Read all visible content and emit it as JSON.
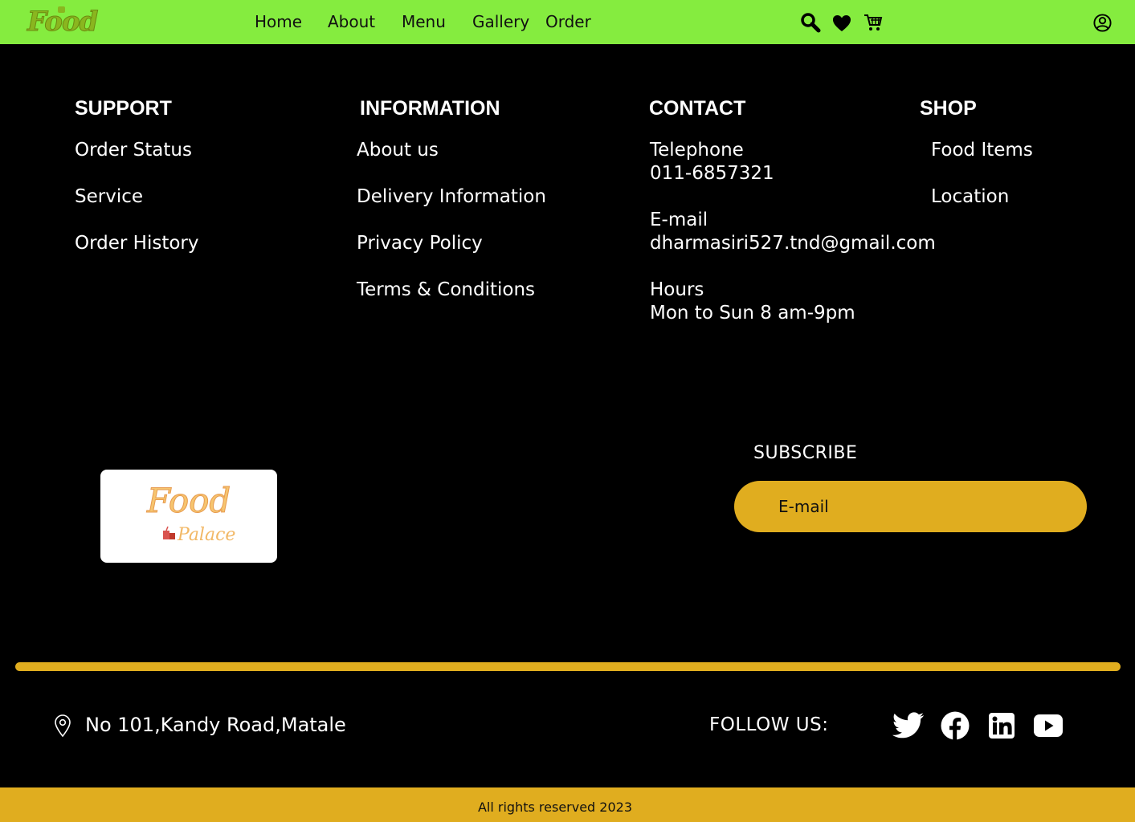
{
  "nav": {
    "logo_text": "Food",
    "links": [
      "Home",
      "About",
      "Menu",
      "Gallery",
      "Order"
    ],
    "icons": [
      "search-icon",
      "heart-icon",
      "cart-icon",
      "user-icon"
    ],
    "bg_color": "#85ec3f"
  },
  "footer": {
    "support": {
      "heading": "SUPPORT",
      "items": [
        "Order Status",
        "Service",
        "Order History"
      ]
    },
    "information": {
      "heading": "INFORMATION",
      "items": [
        "About us",
        "Delivery Information",
        "Privacy Policy",
        "Terms & Conditions"
      ]
    },
    "contact": {
      "heading": "CONTACT",
      "telephone_label": "Telephone",
      "telephone": "011-6857321",
      "email_label": "E-mail",
      "email": "dharmasiri527.tnd@gmail.com",
      "hours_label": "Hours",
      "hours": "Mon to Sun 8 am-9pm"
    },
    "shop": {
      "heading": "SHOP",
      "items": [
        "Food Items",
        "Location"
      ]
    }
  },
  "brand_card": {
    "line1": "Food",
    "line2": "Palace"
  },
  "subscribe": {
    "label": "SUBSCRIBE",
    "placeholder": "E-mail"
  },
  "address": "No 101,Kandy Road,Matale",
  "follow_label": "FOLLOW US:",
  "social_icons": [
    "twitter-icon",
    "facebook-icon",
    "linkedin-icon",
    "youtube-icon"
  ],
  "copyright": "All rights reserved 2023",
  "colors": {
    "accent": "#e0ad1f",
    "nav": "#85ec3f",
    "background": "#000000"
  }
}
